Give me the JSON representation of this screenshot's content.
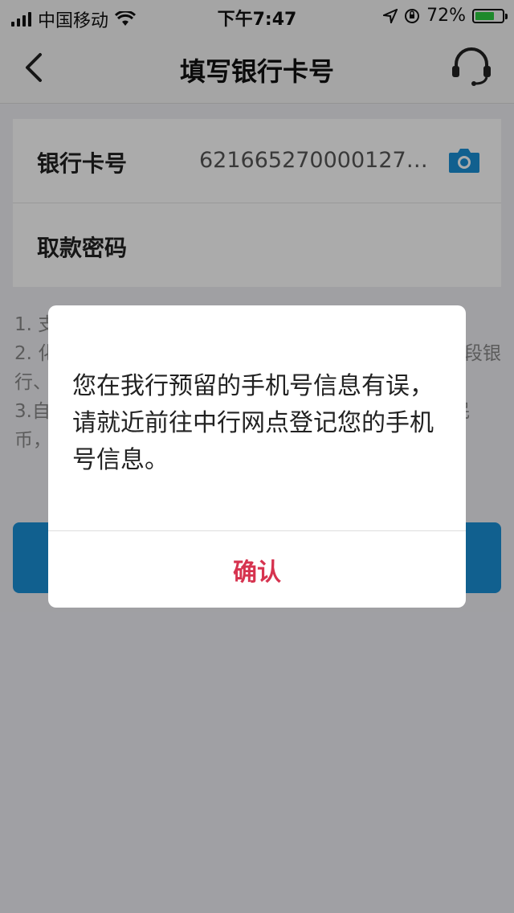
{
  "status_bar": {
    "carrier": "中国移动",
    "time": "下午7:47",
    "battery": "72%",
    "battery_level": 0.72,
    "icons": [
      "signal-icon",
      "wifi-icon",
      "location-icon",
      "orientation-lock-icon",
      "battery-charging-icon"
    ]
  },
  "nav": {
    "title": "填写银行卡号",
    "back_icon": "chevron-left-icon",
    "support_icon": "headset-icon"
  },
  "form": {
    "card_label": "银行卡号",
    "card_value": "6216652700001273...",
    "camera_icon": "camera-icon",
    "password_label": "取款密码",
    "password_value": ""
  },
  "notes": {
    "line1": "1. 支",
    "line2a": "2. 化",
    "line2b": "段银",
    "line3": "行、",
    "line4a": "3.自",
    "line4b": "民",
    "line5": "币，"
  },
  "dialog": {
    "message": "您在我行预留的手机号信息有误，请就近前往中行网点登记您的手机号信息。",
    "confirm_label": "确认",
    "confirm_color": "#d6334f"
  },
  "colors": {
    "primary": "#1a8fd6",
    "accent": "#d6334f"
  }
}
